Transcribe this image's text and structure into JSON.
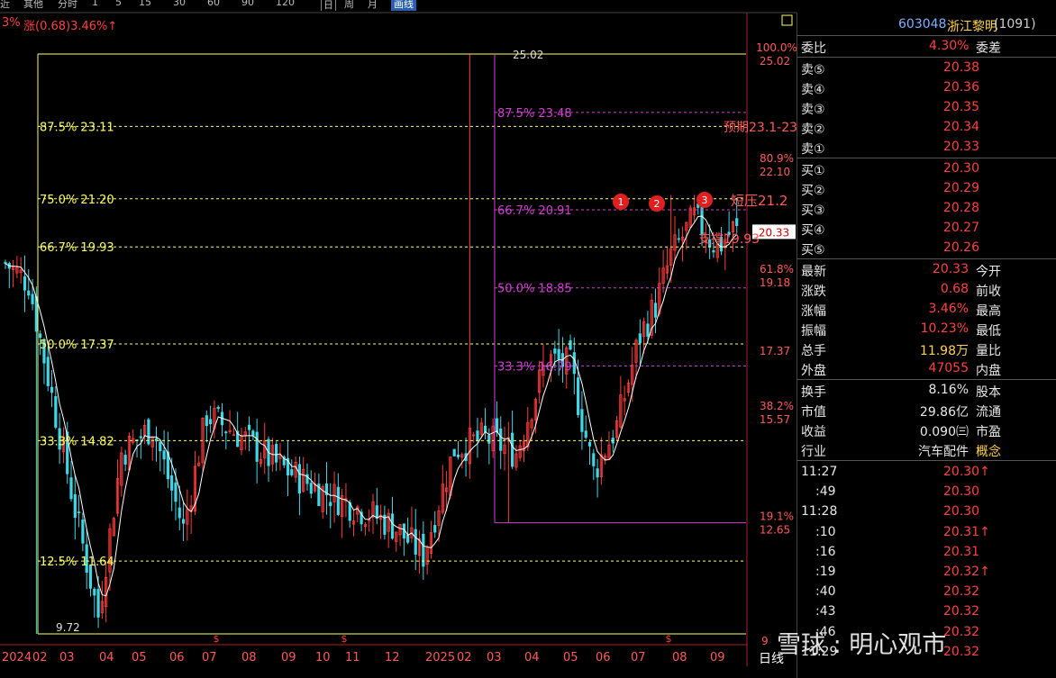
{
  "toolbar": {
    "items": [
      "近",
      "其他",
      "分时",
      "1",
      "5",
      "15",
      "30",
      "60",
      "90",
      "120",
      "日",
      "周",
      "月",
      "画线"
    ],
    "change_prefix": "3%",
    "change_text": "涨(0.68)3.46%↑"
  },
  "stock": {
    "code": "603048",
    "name": "浙江黎明",
    "suffix": "(1091)"
  },
  "order_ratio": {
    "label": "委比",
    "value": "4.30%",
    "label2": "委差"
  },
  "asks": [
    {
      "label": "卖⑤",
      "price": "20.38"
    },
    {
      "label": "卖④",
      "price": "20.36"
    },
    {
      "label": "卖③",
      "price": "20.35"
    },
    {
      "label": "卖②",
      "price": "20.34"
    },
    {
      "label": "卖①",
      "price": "20.33"
    }
  ],
  "bids": [
    {
      "label": "买①",
      "price": "20.30"
    },
    {
      "label": "买②",
      "price": "20.29"
    },
    {
      "label": "买③",
      "price": "20.28"
    },
    {
      "label": "买④",
      "price": "20.27"
    },
    {
      "label": "买⑤",
      "price": "20.26"
    }
  ],
  "quote": [
    {
      "label": "最新",
      "value": "20.33",
      "label2": "今开"
    },
    {
      "label": "涨跌",
      "value": "0.68",
      "label2": "前收"
    },
    {
      "label": "涨幅",
      "value": "3.46%",
      "label2": "最高"
    },
    {
      "label": "振幅",
      "value": "10.23%",
      "label2": "最低"
    },
    {
      "label": "总手",
      "value": "11.98万",
      "label2": "量比"
    },
    {
      "label": "外盘",
      "value": "47055",
      "label2": "内盘"
    }
  ],
  "stats": [
    {
      "label": "换手",
      "value": "8.16%",
      "label2": "股本"
    },
    {
      "label": "市值",
      "value": "29.86亿",
      "label2": "流通"
    },
    {
      "label": "收益",
      "value": "0.090㈢",
      "label2": "市盈"
    },
    {
      "label": "行业",
      "value": "汽车配件",
      "label2": "概念"
    }
  ],
  "ticks": [
    {
      "time": "11:27",
      "price": "20.30↑"
    },
    {
      "time": ":49",
      "price": "20.30"
    },
    {
      "time": "11:28",
      "price": "20.30"
    },
    {
      "time": ":10",
      "price": "20.31↑"
    },
    {
      "time": ":16",
      "price": "20.31"
    },
    {
      "time": ":19",
      "price": "20.32↑"
    },
    {
      "time": ":40",
      "price": "20.32"
    },
    {
      "time": ":43",
      "price": "20.32"
    },
    {
      "time": ":46",
      "price": "20.32"
    },
    {
      "time": "11:29",
      "price": "20.32"
    }
  ],
  "chart_data": {
    "type": "candlestick",
    "period": "日线",
    "x_ticks": [
      "2024",
      "02",
      "03",
      "04",
      "05",
      "06",
      "07",
      "08",
      "09",
      "10",
      "11",
      "12",
      "2025",
      "02",
      "03",
      "04",
      "05",
      "06",
      "07",
      "08",
      "09"
    ],
    "ylim": [
      9.5,
      26
    ],
    "current_price": "20.33",
    "marks": {
      "high_label": "25.02",
      "low_label": "9.72",
      "right_low_label": "9"
    },
    "fib_left": [
      {
        "label": "87.5% 23.11",
        "value": 23.11
      },
      {
        "label": "75.0% 21.20",
        "value": 21.2
      },
      {
        "label": "66.7% 19.93",
        "value": 19.93
      },
      {
        "label": "50.0% 17.37",
        "value": 17.37
      },
      {
        "label": "33.3% 14.82",
        "value": 14.82
      },
      {
        "label": "12.5% 11.64",
        "value": 11.64
      }
    ],
    "fib_inner": [
      {
        "label": "87.5% 23.48",
        "value": 23.48
      },
      {
        "label": "66.7% 20.91",
        "value": 20.91
      },
      {
        "label": "50.0% 18.85",
        "value": 18.85
      },
      {
        "label": "33.3% 16.79",
        "value": 16.79
      }
    ],
    "fib_right": [
      {
        "pct": "100.0%",
        "price": "25.02",
        "value": 25.02
      },
      {
        "pct": "80.9%",
        "price": "22.10",
        "value": 22.1
      },
      {
        "pct": "61.8%",
        "price": "19.18",
        "value": 19.18
      },
      {
        "pct": "",
        "price": "17.37",
        "value": 17.37
      },
      {
        "pct": "38.2%",
        "price": "15.57",
        "value": 15.57
      },
      {
        "pct": "19.1%",
        "price": "12.65",
        "value": 12.65
      }
    ],
    "annotations": [
      "预期23.1-23.48",
      "短压21.2",
      "支撑19.93"
    ],
    "circle_markers": [
      "1",
      "2",
      "3"
    ],
    "dividend_marker": "$",
    "colors": {
      "up": "#ff3b3b",
      "down": "#3fd7e6",
      "ma": "#ffffff",
      "fib_yellow": "#ffff60",
      "fib_magenta": "#d040d0",
      "annotation": "#ff5a5a"
    }
  }
}
